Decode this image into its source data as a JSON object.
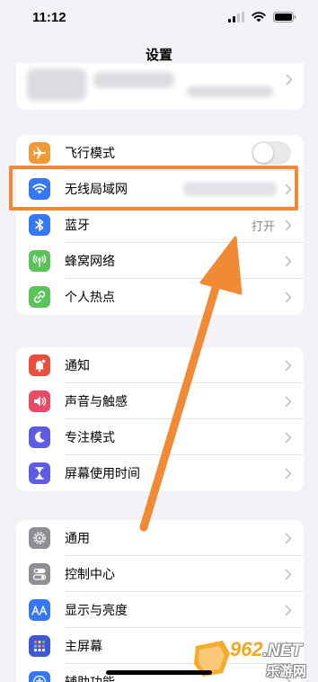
{
  "status_bar": {
    "time": "11:12"
  },
  "page": {
    "title": "设置"
  },
  "groups": {
    "connectivity": [
      {
        "label": "飞行模式",
        "icon": "airplane-icon",
        "color": "#f19a37",
        "control": "toggle",
        "toggle_on": false
      },
      {
        "label": "无线局域网",
        "icon": "wifi-icon",
        "color": "#3478f6",
        "value": ""
      },
      {
        "label": "蓝牙",
        "icon": "bluetooth-icon",
        "color": "#3478f6",
        "value": "打开"
      },
      {
        "label": "蜂窝网络",
        "icon": "antenna-icon",
        "color": "#5ac35a"
      },
      {
        "label": "个人热点",
        "icon": "hotspot-link-icon",
        "color": "#5ac35a"
      }
    ],
    "notifications": [
      {
        "label": "通知",
        "icon": "bell-icon",
        "color": "#eb4d3d"
      },
      {
        "label": "声音与触感",
        "icon": "speaker-icon",
        "color": "#eb4b62"
      },
      {
        "label": "专注模式",
        "icon": "moon-icon",
        "color": "#5e5ce6"
      },
      {
        "label": "屏幕使用时间",
        "icon": "hourglass-icon",
        "color": "#5e5ce6"
      }
    ],
    "general": [
      {
        "label": "通用",
        "icon": "gear-icon",
        "color": "#8e8e93"
      },
      {
        "label": "控制中心",
        "icon": "switches-icon",
        "color": "#8e8e93"
      },
      {
        "label": "显示与亮度",
        "icon": "text-size-icon",
        "color": "#3478f6"
      },
      {
        "label": "主屏幕",
        "icon": "grid-icon",
        "color": "#3d57d6"
      },
      {
        "label": "辅助功能",
        "icon": "accessibility-icon",
        "color": "#3478f6"
      }
    ]
  },
  "annotation": {
    "color": "#f08a35"
  },
  "watermark": {
    "number": "962",
    "suffix": ".NET",
    "chinese": "乐游网"
  }
}
